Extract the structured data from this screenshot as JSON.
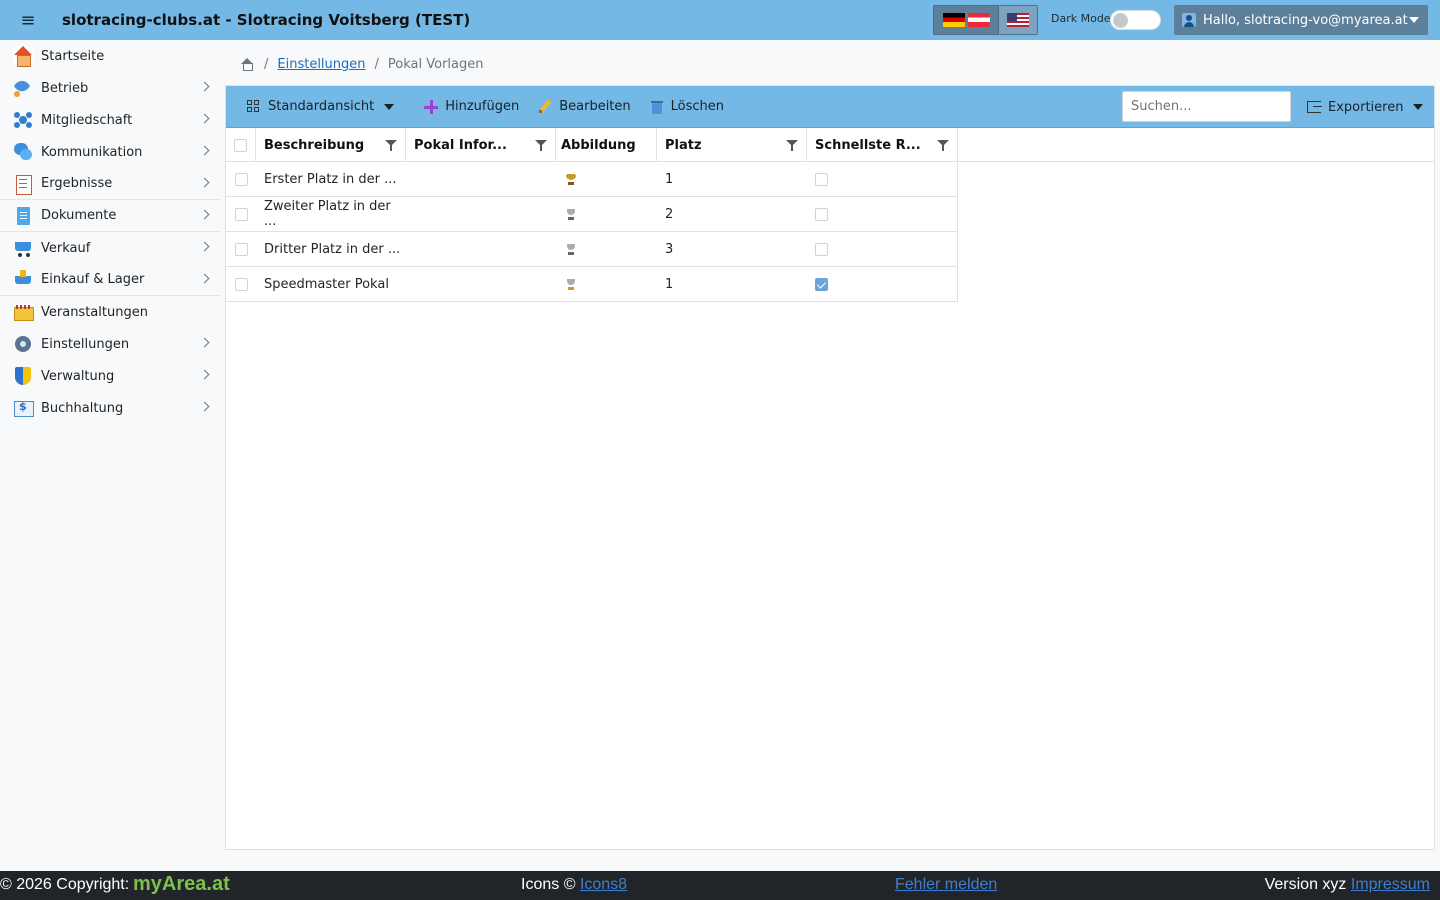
{
  "header": {
    "menu_glyph": "≡",
    "title": "slotracing-clubs.at - Slotracing Voitsberg (TEST)",
    "dark_mode_label": "Dark Mode",
    "user_label": "Hallo, slotracing-vo@myarea.at",
    "languages": [
      "de-at",
      "en-us"
    ]
  },
  "sidebar": {
    "items": [
      {
        "label": "Startseite",
        "icon": "home-icon",
        "chevron": false
      },
      {
        "label": "Betrieb",
        "icon": "rocket-icon",
        "chevron": true
      },
      {
        "label": "Mitgliedschaft",
        "icon": "network-icon",
        "chevron": true
      },
      {
        "label": "Kommunikation",
        "icon": "chat-icon",
        "chevron": true
      },
      {
        "label": "Ergebnisse",
        "icon": "list-icon",
        "chevron": true
      },
      {
        "label": "Dokumente",
        "icon": "document-icon",
        "chevron": true
      },
      {
        "label": "Verkauf",
        "icon": "cart-icon",
        "chevron": true
      },
      {
        "label": "Einkauf & Lager",
        "icon": "cart-in-icon",
        "chevron": true
      },
      {
        "label": "Veranstaltungen",
        "icon": "calendar-icon",
        "chevron": false
      },
      {
        "label": "Einstellungen",
        "icon": "gear-icon",
        "chevron": true
      },
      {
        "label": "Verwaltung",
        "icon": "shield-icon",
        "chevron": true
      },
      {
        "label": "Buchhaltung",
        "icon": "bill-icon",
        "chevron": true
      }
    ]
  },
  "breadcrumb": {
    "sep": "/",
    "parent": "Einstellungen",
    "current": "Pokal Vorlagen"
  },
  "toolbar": {
    "view_label": "Standardansicht",
    "add_label": "Hinzufügen",
    "edit_label": "Bearbeiten",
    "delete_label": "Löschen",
    "search_placeholder": "Suchen...",
    "export_label": "Exportieren"
  },
  "grid": {
    "columns": [
      "Beschreibung",
      "Pokal Infor...",
      "Abbildung",
      "Platz",
      "Schnellste R..."
    ],
    "rows": [
      {
        "beschreibung": "Erster Platz in der ...",
        "pokal_info": "",
        "abbildung": "gold-trophy-icon",
        "platz": "1",
        "schnellste": false
      },
      {
        "beschreibung": "Zweiter Platz in der ...",
        "pokal_info": "",
        "abbildung": "silver-trophy-icon",
        "platz": "2",
        "schnellste": false
      },
      {
        "beschreibung": "Dritter Platz in der ...",
        "pokal_info": "",
        "abbildung": "silver-trophy-icon",
        "platz": "3",
        "schnellste": false
      },
      {
        "beschreibung": "Speedmaster Pokal",
        "pokal_info": "",
        "abbildung": "speed-trophy-icon",
        "platz": "1",
        "schnellste": true
      }
    ]
  },
  "footer": {
    "copyright": "© 2026 Copyright:",
    "brand_a": "myArea",
    "brand_b": ".at",
    "icons_prefix": "Icons ©",
    "icons_link": "Icons8",
    "bug_link": "Fehler melden",
    "version": "Version xyz",
    "impressum_link": "Impressum"
  },
  "colors": {
    "header_bg": "#74b9e6",
    "toolbar_bg": "#74b9e6",
    "footer_bg": "#212529",
    "brand_green": "#7fbf4d",
    "link_blue": "#1b6ec2"
  }
}
